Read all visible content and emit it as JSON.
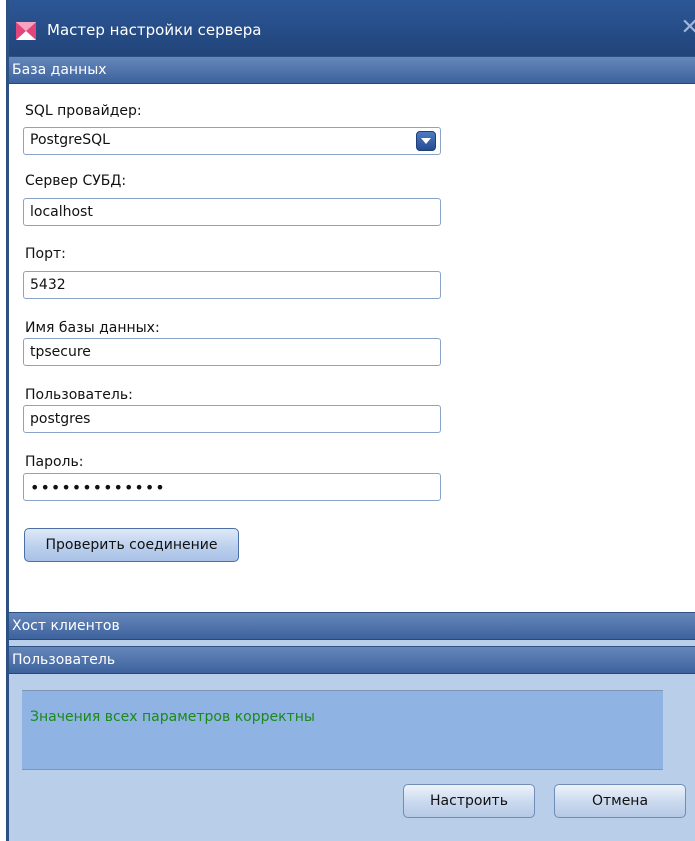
{
  "window": {
    "title": "Мастер настройки сервера",
    "close_glyph": "✕"
  },
  "sections": {
    "database": "База данных",
    "clients_host": "Хост клиентов",
    "user": "Пользователь"
  },
  "form": {
    "provider_label": "SQL провайдер:",
    "provider_value": "PostgreSQL",
    "server_label": "Сервер СУБД:",
    "server_value": "localhost",
    "port_label": "Порт:",
    "port_value": "5432",
    "dbname_label": "Имя базы данных:",
    "dbname_value": "tpsecure",
    "username_label": "Пользователь:",
    "username_value": "postgres",
    "password_label": "Пароль:",
    "password_value": "•••••••••••••",
    "test_button": "Проверить соединение"
  },
  "status": {
    "message": "Значения всех параметров корректны",
    "color": "#1a8a1a"
  },
  "footer": {
    "configure_button": "Настроить",
    "cancel_button": "Отмена"
  },
  "icons": {
    "app": "app-logo-icon",
    "close": "close-icon",
    "dropdown": "chevron-down-icon"
  },
  "colors": {
    "titlebar": "#214479",
    "section_header": "#3d629c",
    "status_background": "#8fb3e3"
  }
}
